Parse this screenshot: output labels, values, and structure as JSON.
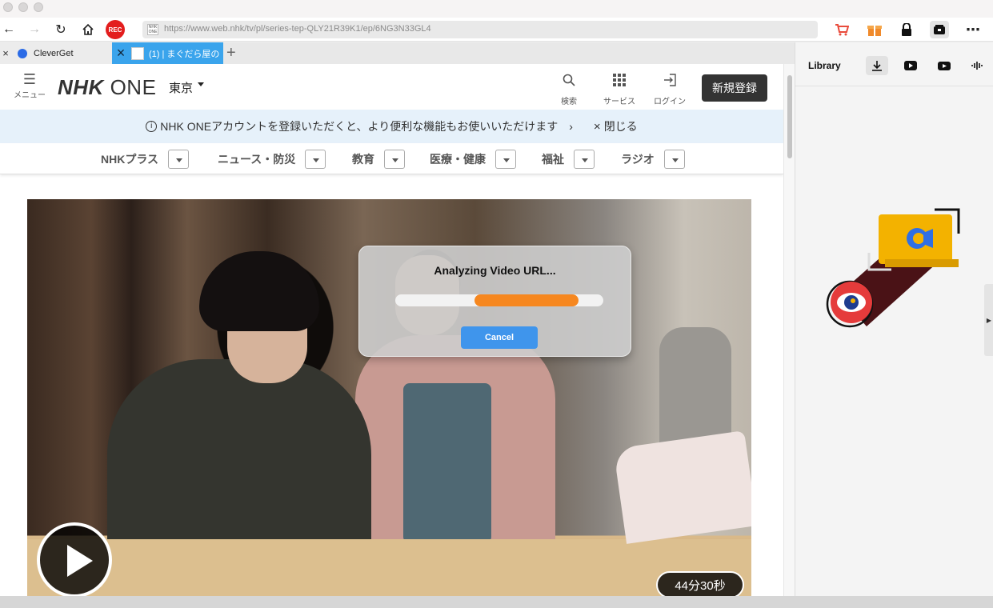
{
  "toolbar": {
    "url": "https://www.web.nhk/tv/pl/series-tep-QLY21R39K1/ep/6NG3N33GL4",
    "rec_label": "REC",
    "favicon_text": "NHK ONE"
  },
  "tabs": [
    {
      "label": "CleverGet"
    },
    {
      "label": "(1) | まぐだら屋の"
    }
  ],
  "nhk": {
    "menu_label": "メニュー",
    "logo_bold": "NHK",
    "logo_light": "ONE",
    "region": "東京",
    "search_label": "検索",
    "services_label": "サービス",
    "login_label": "ログイン",
    "signup_label": "新規登録",
    "banner_text": "NHK ONEアカウントを登録いただくと、より便利な機能もお使いいただけます",
    "banner_close": "閉じる",
    "categories": [
      "NHKプラス",
      "ニュース・防災",
      "教育",
      "医療・健康",
      "福祉",
      "ラジオ"
    ]
  },
  "video": {
    "duration": "44分30秒"
  },
  "dialog": {
    "title": "Analyzing Video URL...",
    "cancel_label": "Cancel",
    "progress_start": 0.38,
    "progress_end": 0.88,
    "accent": "#f6871f",
    "button_color": "#3f95ec"
  },
  "panel": {
    "title": "Library"
  }
}
